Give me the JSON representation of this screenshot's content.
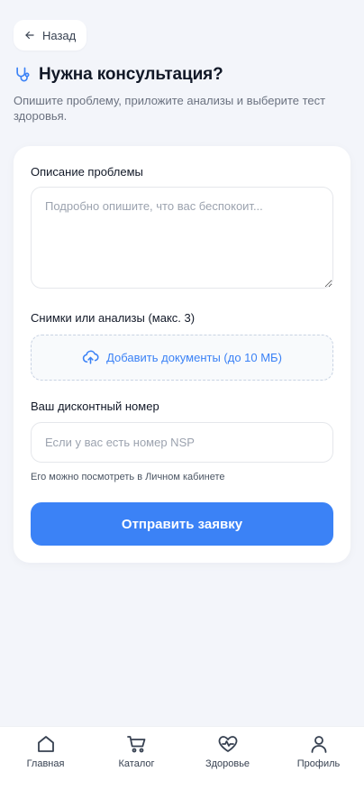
{
  "header": {
    "back_label": "Назад",
    "title": "Нужна консультация?",
    "subtitle": "Опишите проблему, приложите анализы и выберите тест здоровья."
  },
  "form": {
    "description": {
      "label": "Описание проблемы",
      "placeholder": "Подробно опишите, что вас беспокоит...",
      "value": ""
    },
    "attachments": {
      "label": "Снимки или анализы (макс. 3)",
      "upload_label": "Добавить документы (до 10 МБ)",
      "icon": "cloud-upload-icon"
    },
    "discount": {
      "label": "Ваш дисконтный номер",
      "placeholder": "Если у вас есть номер NSP",
      "value": "",
      "hint": "Его можно посмотреть в Личном кабинете"
    },
    "submit_label": "Отправить заявку"
  },
  "nav": {
    "items": [
      {
        "label": "Главная",
        "icon": "home-icon"
      },
      {
        "label": "Каталог",
        "icon": "cart-icon"
      },
      {
        "label": "Здоровье",
        "icon": "heart-pulse-icon"
      },
      {
        "label": "Профиль",
        "icon": "user-icon"
      }
    ]
  },
  "colors": {
    "background": "#f3f5fa",
    "accent": "#3b82f6",
    "title_icon": "#3b82f6",
    "text": "#111827",
    "muted": "#6b7280"
  }
}
